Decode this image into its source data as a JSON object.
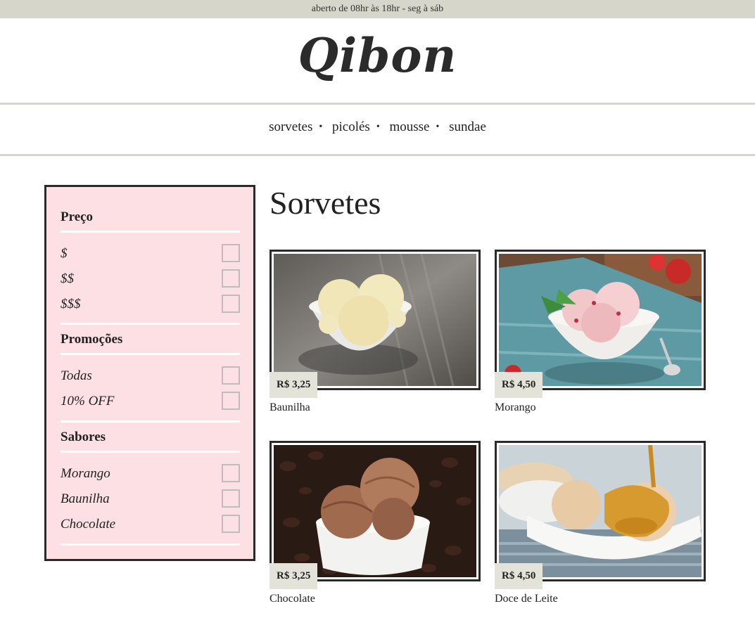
{
  "topbar": {
    "hours": "aberto de 08hr às 18hr - seg à sáb"
  },
  "brand": {
    "logo": "Qibon"
  },
  "nav": {
    "items": [
      "sorvetes",
      "picolés",
      "mousse",
      "sundae"
    ]
  },
  "filters": {
    "groups": [
      {
        "title": "Preço",
        "options": [
          "$",
          "$$",
          "$$$"
        ]
      },
      {
        "title": "Promoções",
        "options": [
          "Todas",
          "10% OFF"
        ]
      },
      {
        "title": "Sabores",
        "options": [
          "Morango",
          "Baunilha",
          "Chocolate"
        ]
      }
    ]
  },
  "main": {
    "title": "Sorvetes",
    "products": [
      {
        "name": "Baunilha",
        "price": "R$ 3,25",
        "image": "vanilla-ice-cream-bowl"
      },
      {
        "name": "Morango",
        "price": "R$ 4,50",
        "image": "strawberry-ice-cream-bowl"
      },
      {
        "name": "Chocolate",
        "price": "R$ 3,25",
        "image": "chocolate-ice-cream-bowl"
      },
      {
        "name": "Doce de Leite",
        "price": "R$ 4,50",
        "image": "dulce-de-leche-ice-cream-bowl"
      }
    ]
  },
  "colors": {
    "topbar": "#d7d6cb",
    "sidebar": "#fde0e3",
    "border": "#2a2a2a",
    "price_tag": "#e4e3da"
  }
}
